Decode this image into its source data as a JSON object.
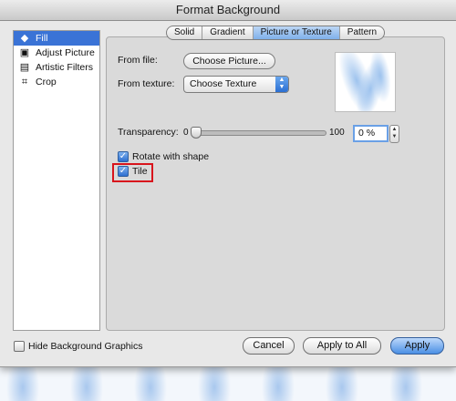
{
  "window": {
    "title": "Format Background"
  },
  "sidebar": {
    "items": [
      {
        "label": "Fill",
        "icon": "fill-bucket-icon",
        "selected": true
      },
      {
        "label": "Adjust Picture",
        "icon": "adjust-picture-icon",
        "selected": false
      },
      {
        "label": "Artistic Filters",
        "icon": "artistic-filters-icon",
        "selected": false
      },
      {
        "label": "Crop",
        "icon": "crop-icon",
        "selected": false
      }
    ]
  },
  "tabs": [
    {
      "label": "Solid",
      "active": false
    },
    {
      "label": "Gradient",
      "active": false
    },
    {
      "label": "Picture or Texture",
      "active": true
    },
    {
      "label": "Pattern",
      "active": false
    }
  ],
  "fill": {
    "from_file_label": "From file:",
    "choose_picture_button": "Choose Picture...",
    "from_texture_label": "From texture:",
    "texture_select_value": "Choose Texture",
    "transparency_label": "Transparency:",
    "slider_min_label": "0",
    "slider_max_label": "100",
    "transparency_value": "0 %",
    "transparency_level": 0,
    "rotate_with_shape": {
      "label": "Rotate with shape",
      "checked": true
    },
    "tile": {
      "label": "Tile",
      "checked": true
    }
  },
  "footer": {
    "hide_background_graphics": {
      "label": "Hide Background Graphics",
      "checked": false
    },
    "cancel_button": "Cancel",
    "apply_to_all_button": "Apply to All",
    "apply_button": "Apply"
  },
  "colors": {
    "accent": "#3a73d6",
    "highlight": "#d8141c"
  }
}
